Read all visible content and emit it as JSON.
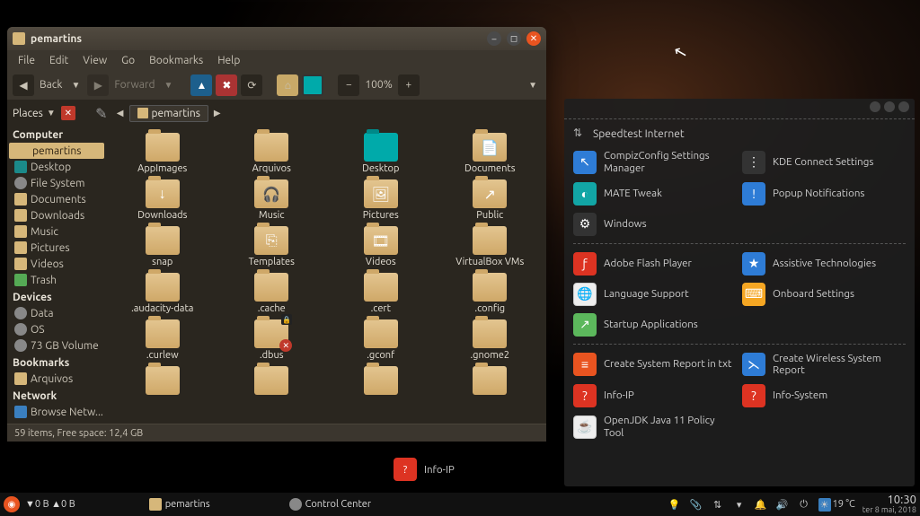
{
  "fm": {
    "title": "pemartins",
    "menus": [
      "File",
      "Edit",
      "View",
      "Go",
      "Bookmarks",
      "Help"
    ],
    "back": "Back",
    "forward": "Forward",
    "zoom": "100%",
    "places_label": "Places",
    "breadcrumb": "pemartins",
    "status": "59 items, Free space: 12,4 GB",
    "sidebar": {
      "computer_hdr": "Computer",
      "computer": [
        {
          "label": "pemartins",
          "sel": true,
          "ico": "home"
        },
        {
          "label": "Desktop",
          "ico": "blue"
        },
        {
          "label": "File System",
          "ico": "disk"
        },
        {
          "label": "Documents",
          "ico": "fld"
        },
        {
          "label": "Downloads",
          "ico": "fld"
        },
        {
          "label": "Music",
          "ico": "fld"
        },
        {
          "label": "Pictures",
          "ico": "fld"
        },
        {
          "label": "Videos",
          "ico": "fld"
        },
        {
          "label": "Trash",
          "ico": "green"
        }
      ],
      "devices_hdr": "Devices",
      "devices": [
        {
          "label": "Data",
          "ico": "disk"
        },
        {
          "label": "OS",
          "ico": "disk"
        },
        {
          "label": "73 GB Volume",
          "ico": "disk"
        }
      ],
      "bookmarks_hdr": "Bookmarks",
      "bookmarks": [
        {
          "label": "Arquivos",
          "ico": "fld"
        }
      ],
      "network_hdr": "Network",
      "network": [
        {
          "label": "Browse Netw...",
          "ico": "net"
        }
      ]
    },
    "folders": [
      {
        "name": "AppImages"
      },
      {
        "name": "Arquivos"
      },
      {
        "name": "Desktop",
        "kind": "desktop"
      },
      {
        "name": "Documents",
        "ovl": "📄"
      },
      {
        "name": "Downloads",
        "ovl": "↓"
      },
      {
        "name": "Music",
        "ovl": "🎧"
      },
      {
        "name": "Pictures",
        "ovl": "🖼"
      },
      {
        "name": "Public",
        "ovl": "↗"
      },
      {
        "name": "snap"
      },
      {
        "name": "Templates",
        "ovl": "⎘"
      },
      {
        "name": "Videos",
        "ovl": "🎞"
      },
      {
        "name": "VirtualBox VMs"
      },
      {
        "name": ".audacity-data"
      },
      {
        "name": ".cache"
      },
      {
        "name": ".cert"
      },
      {
        "name": ".config"
      },
      {
        "name": ".curlew"
      },
      {
        "name": ".dbus",
        "lock": true,
        "err": true
      },
      {
        "name": ".gconf"
      },
      {
        "name": ".gnome2"
      },
      {
        "name": ""
      },
      {
        "name": ""
      },
      {
        "name": ""
      },
      {
        "name": ""
      }
    ]
  },
  "cc": {
    "section_internet": "Speedtest Internet",
    "g1": [
      {
        "label": "CompizConfig Settings Manager",
        "c": "blue",
        "g": "↖"
      },
      {
        "label": "KDE Connect Settings",
        "c": "dark",
        "g": "⋮"
      },
      {
        "label": "MATE Tweak",
        "c": "teal",
        "g": "◐"
      },
      {
        "label": "Popup Notifications",
        "c": "blue",
        "g": "!"
      },
      {
        "label": "Windows",
        "c": "dark",
        "g": "⚙"
      }
    ],
    "g2": [
      {
        "label": "Adobe Flash Player",
        "c": "red",
        "g": "ƒ"
      },
      {
        "label": "Assistive Technologies",
        "c": "blue",
        "g": "★"
      },
      {
        "label": "Language Support",
        "c": "wht",
        "g": "🌐"
      },
      {
        "label": "Onboard Settings",
        "c": "ylw",
        "g": "⌨"
      },
      {
        "label": "Startup Applications",
        "c": "grn",
        "g": "↗"
      }
    ],
    "g3": [
      {
        "label": "Create System Report in txt",
        "c": "org",
        "g": "≡"
      },
      {
        "label": "Create Wireless System Report",
        "c": "blue",
        "g": "⋋"
      },
      {
        "label": "Info-IP",
        "c": "red",
        "g": "?"
      },
      {
        "label": "Info-System",
        "c": "red",
        "g": "?"
      },
      {
        "label": "OpenJDK Java 11 Policy Tool",
        "c": "wht",
        "g": "☕"
      }
    ]
  },
  "taskbar": {
    "net": "▼0 B ▲0 B",
    "t1": "pemartins",
    "t2": "Control Center",
    "weather": "19 °C",
    "clock": "10:30",
    "date": "ter  8 mai, 2018"
  }
}
